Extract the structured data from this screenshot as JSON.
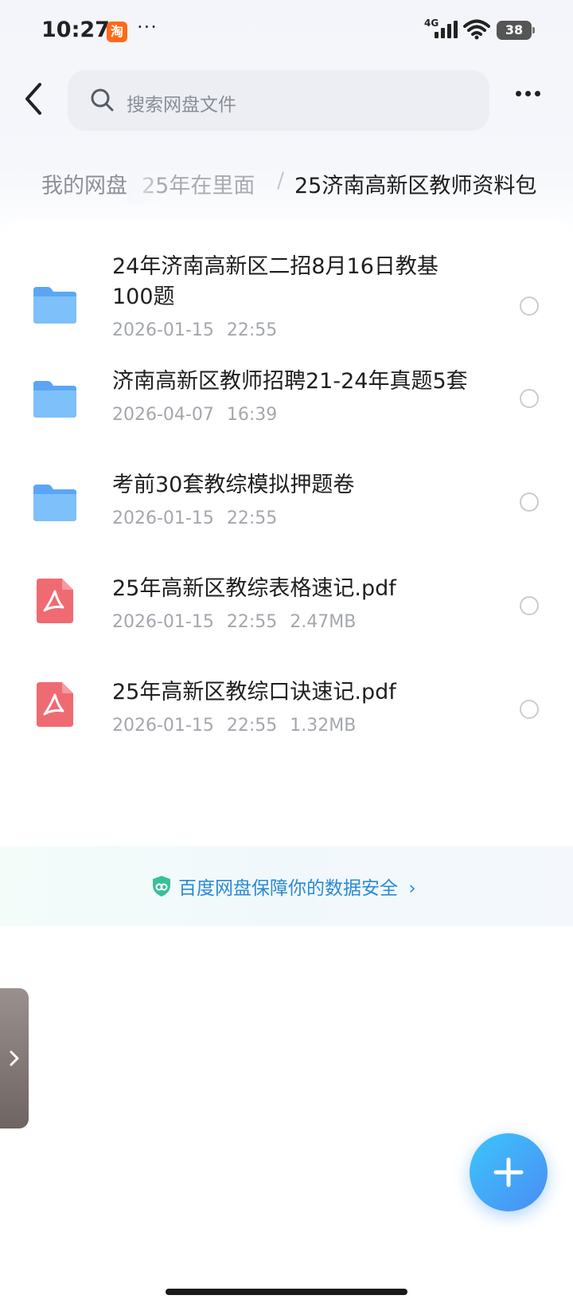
{
  "status_bar": {
    "time": "10:27",
    "app_badge": "淘",
    "more": "···",
    "network": "4G",
    "battery": "38"
  },
  "header": {
    "search_placeholder": "搜索网盘文件"
  },
  "breadcrumb": {
    "root": "我的网盘",
    "middle": "25年在里面",
    "separator": "/",
    "current": "25济南高新区教师资料包"
  },
  "files": [
    {
      "type": "folder",
      "title": "24年济南高新区二招8月16日教基100题",
      "date": "2026-01-15",
      "time": "22:55",
      "size": ""
    },
    {
      "type": "folder",
      "title": "济南高新区教师招聘21-24年真题5套",
      "date": "2026-04-07",
      "time": "16:39",
      "size": ""
    },
    {
      "type": "folder",
      "title": "考前30套教综模拟押题卷",
      "date": "2026-01-15",
      "time": "22:55",
      "size": ""
    },
    {
      "type": "pdf",
      "title": "25年高新区教综表格速记.pdf",
      "date": "2026-01-15",
      "time": "22:55",
      "size": "2.47MB"
    },
    {
      "type": "pdf",
      "title": "25年高新区教综口诀速记.pdf",
      "date": "2026-01-15",
      "time": "22:55",
      "size": "1.32MB"
    }
  ],
  "security": {
    "text": "百度网盘保障你的数据安全",
    "arrow": "›"
  },
  "colors": {
    "folder": "#5aa6f4",
    "pdf": "#f06a72",
    "accent": "#2a8ad4",
    "fab": "#3fa8f8"
  }
}
